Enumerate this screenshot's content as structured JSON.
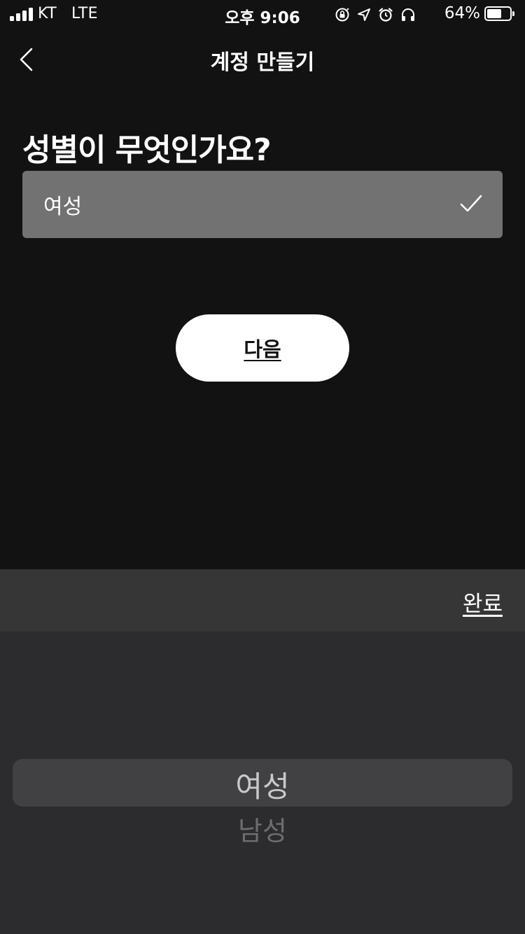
{
  "status_bar": {
    "carrier": "KT",
    "network": "LTE",
    "time": "오후 9:06",
    "battery_percent": "64%",
    "battery_level": 0.64,
    "icons": [
      "orientation-lock-icon",
      "location-icon",
      "alarm-icon",
      "headphones-icon"
    ]
  },
  "nav": {
    "back_icon": "chevron-left-icon",
    "title": "계정 만들기"
  },
  "question": "성별이 무엇인가요?",
  "gender_field": {
    "value": "여성",
    "icon": "checkmark-icon"
  },
  "next_button": {
    "label": "다음"
  },
  "picker": {
    "done_label": "완료",
    "selected_option": "여성",
    "options": [
      "여성",
      "남성"
    ]
  },
  "colors": {
    "background": "#121212",
    "field_background": "#727272",
    "button_background": "#ffffff",
    "picker_toolbar": "#363636",
    "picker_body": "#2c2c2e",
    "picker_highlight": "#414143"
  }
}
